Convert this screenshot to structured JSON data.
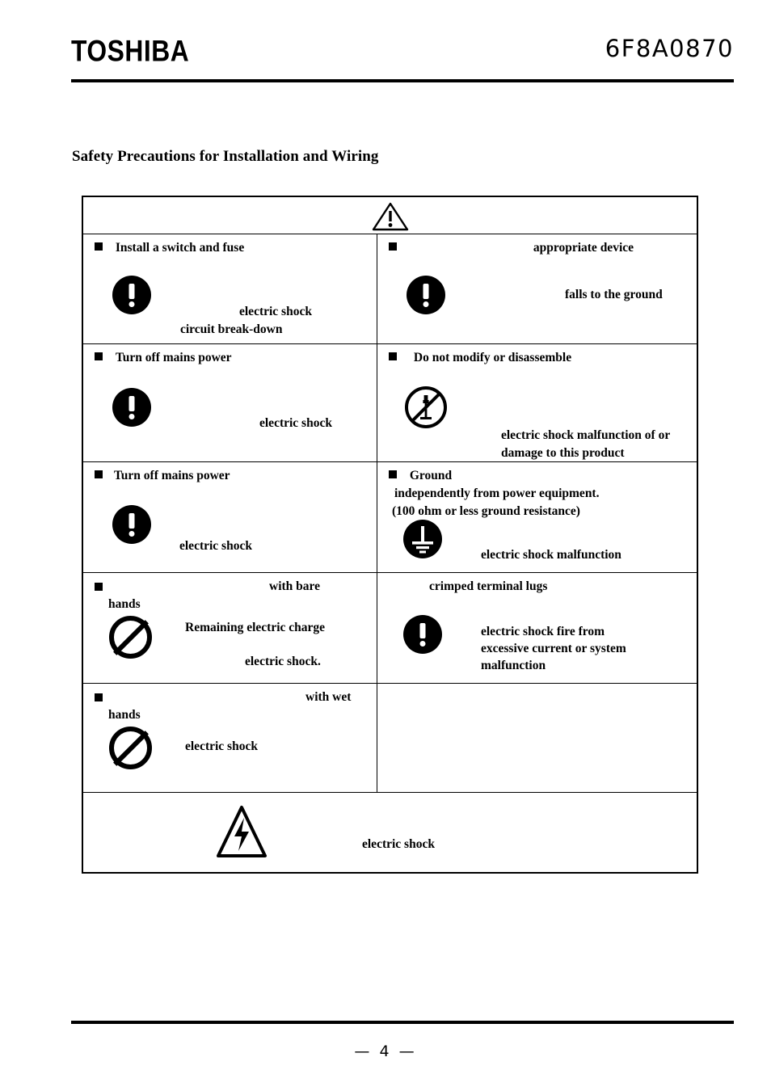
{
  "header": {
    "brand": "TOSHIBA",
    "document_number": "6F8A0870"
  },
  "section": {
    "title": "Safety Precautions for Installation and Wiring"
  },
  "warning_banner": {
    "icon": "warning-triangle-icon"
  },
  "table": {
    "rows": [
      {
        "left": {
          "bullet": true,
          "heading": "Install a switch and fuse",
          "icon": "mandatory-exclamation-icon",
          "lines": [
            "electric shock",
            "circuit break-down"
          ]
        },
        "right": {
          "bullet": true,
          "heading": "appropriate device",
          "icon": "mandatory-exclamation-icon",
          "lines": [
            "falls to the ground"
          ]
        }
      },
      {
        "left": {
          "bullet": true,
          "heading": "Turn off mains power",
          "icon": "mandatory-exclamation-icon",
          "lines": [
            "electric shock"
          ]
        },
        "right": {
          "bullet": true,
          "heading": "Do not modify or disassemble",
          "icon": "no-disassembly-icon",
          "lines": [
            "electric shock  malfunction of or",
            "damage to this product"
          ]
        }
      },
      {
        "left": {
          "bullet": true,
          "heading": "Turn off mains power",
          "icon": "mandatory-exclamation-icon",
          "lines": [
            "electric shock"
          ]
        },
        "right": {
          "bullet": true,
          "heading": "Ground",
          "subheadings": [
            "independently from power equipment.",
            "(100 ohm or less ground resistance)"
          ],
          "icon": "ground-symbol-icon",
          "lines": [
            "electric shock     malfunction"
          ]
        }
      },
      {
        "left": {
          "bullet": true,
          "heading": "with bare",
          "heading2": "hands",
          "icon": "prohibition-icon",
          "lines": [
            "Remaining electric charge",
            "electric shock."
          ]
        },
        "right": {
          "bullet": false,
          "heading": "crimped terminal lugs",
          "icon": "mandatory-exclamation-icon",
          "lines": [
            "electric shock  fire from",
            "excessive current or system",
            "malfunction"
          ]
        }
      },
      {
        "left": {
          "bullet": true,
          "heading": "with wet",
          "heading2": "hands",
          "icon": "prohibition-icon",
          "lines": [
            "electric shock"
          ]
        },
        "right": {
          "bullet": false,
          "heading": "",
          "icon": "",
          "lines": []
        }
      }
    ],
    "footer_row": {
      "icon": "high-voltage-icon",
      "text": "electric shock"
    }
  },
  "footer": {
    "page_number": "—  4  —"
  },
  "colors": {
    "ink": "#000000",
    "paper": "#ffffff"
  }
}
